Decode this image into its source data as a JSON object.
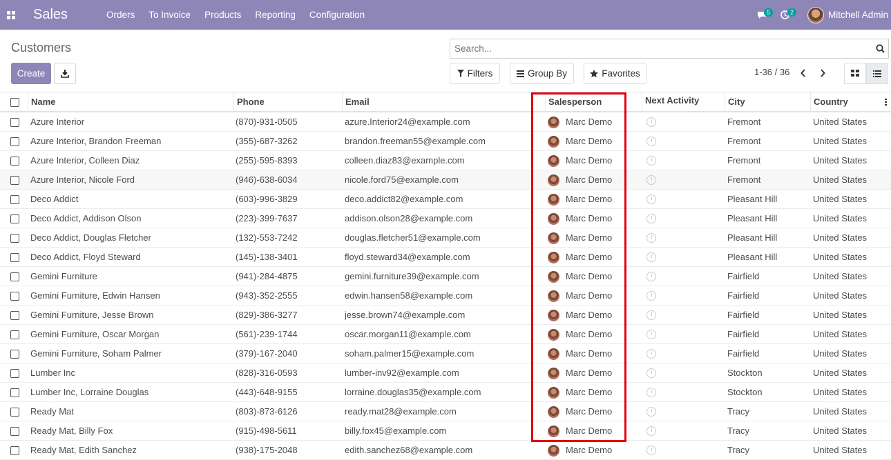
{
  "navbar": {
    "brand": "Sales",
    "menu": [
      "Orders",
      "To Invoice",
      "Products",
      "Reporting",
      "Configuration"
    ],
    "messages_count": "5",
    "activities_count": "2",
    "user_name": "Mitchell Admin"
  },
  "control_panel": {
    "title": "Customers",
    "create_label": "Create",
    "search_placeholder": "Search...",
    "filters_label": "Filters",
    "group_by_label": "Group By",
    "favorites_label": "Favorites",
    "pager": "1-36 / 36"
  },
  "columns": {
    "name": "Name",
    "phone": "Phone",
    "email": "Email",
    "salesperson": "Salesperson",
    "next_activity": "Next Activity",
    "city": "City",
    "country": "Country"
  },
  "rows": [
    {
      "name": "Azure Interior",
      "phone": "(870)-931-0505",
      "email": "azure.Interior24@example.com",
      "salesperson": "Marc Demo",
      "city": "Fremont",
      "country": "United States"
    },
    {
      "name": "Azure Interior, Brandon Freeman",
      "phone": "(355)-687-3262",
      "email": "brandon.freeman55@example.com",
      "salesperson": "Marc Demo",
      "city": "Fremont",
      "country": "United States"
    },
    {
      "name": "Azure Interior, Colleen Diaz",
      "phone": "(255)-595-8393",
      "email": "colleen.diaz83@example.com",
      "salesperson": "Marc Demo",
      "city": "Fremont",
      "country": "United States"
    },
    {
      "name": "Azure Interior, Nicole Ford",
      "phone": "(946)-638-6034",
      "email": "nicole.ford75@example.com",
      "salesperson": "Marc Demo",
      "city": "Fremont",
      "country": "United States"
    },
    {
      "name": "Deco Addict",
      "phone": "(603)-996-3829",
      "email": "deco.addict82@example.com",
      "salesperson": "Marc Demo",
      "city": "Pleasant Hill",
      "country": "United States"
    },
    {
      "name": "Deco Addict, Addison Olson",
      "phone": "(223)-399-7637",
      "email": "addison.olson28@example.com",
      "salesperson": "Marc Demo",
      "city": "Pleasant Hill",
      "country": "United States"
    },
    {
      "name": "Deco Addict, Douglas Fletcher",
      "phone": "(132)-553-7242",
      "email": "douglas.fletcher51@example.com",
      "salesperson": "Marc Demo",
      "city": "Pleasant Hill",
      "country": "United States"
    },
    {
      "name": "Deco Addict, Floyd Steward",
      "phone": "(145)-138-3401",
      "email": "floyd.steward34@example.com",
      "salesperson": "Marc Demo",
      "city": "Pleasant Hill",
      "country": "United States"
    },
    {
      "name": "Gemini Furniture",
      "phone": "(941)-284-4875",
      "email": "gemini.furniture39@example.com",
      "salesperson": "Marc Demo",
      "city": "Fairfield",
      "country": "United States"
    },
    {
      "name": "Gemini Furniture, Edwin Hansen",
      "phone": "(943)-352-2555",
      "email": "edwin.hansen58@example.com",
      "salesperson": "Marc Demo",
      "city": "Fairfield",
      "country": "United States"
    },
    {
      "name": "Gemini Furniture, Jesse Brown",
      "phone": "(829)-386-3277",
      "email": "jesse.brown74@example.com",
      "salesperson": "Marc Demo",
      "city": "Fairfield",
      "country": "United States"
    },
    {
      "name": "Gemini Furniture, Oscar Morgan",
      "phone": "(561)-239-1744",
      "email": "oscar.morgan11@example.com",
      "salesperson": "Marc Demo",
      "city": "Fairfield",
      "country": "United States"
    },
    {
      "name": "Gemini Furniture, Soham Palmer",
      "phone": "(379)-167-2040",
      "email": "soham.palmer15@example.com",
      "salesperson": "Marc Demo",
      "city": "Fairfield",
      "country": "United States"
    },
    {
      "name": "Lumber Inc",
      "phone": "(828)-316-0593",
      "email": "lumber-inv92@example.com",
      "salesperson": "Marc Demo",
      "city": "Stockton",
      "country": "United States"
    },
    {
      "name": "Lumber Inc, Lorraine Douglas",
      "phone": "(443)-648-9155",
      "email": "lorraine.douglas35@example.com",
      "salesperson": "Marc Demo",
      "city": "Stockton",
      "country": "United States"
    },
    {
      "name": "Ready Mat",
      "phone": "(803)-873-6126",
      "email": "ready.mat28@example.com",
      "salesperson": "Marc Demo",
      "city": "Tracy",
      "country": "United States"
    },
    {
      "name": "Ready Mat, Billy Fox",
      "phone": "(915)-498-5611",
      "email": "billy.fox45@example.com",
      "salesperson": "Marc Demo",
      "city": "Tracy",
      "country": "United States"
    },
    {
      "name": "Ready Mat, Edith Sanchez",
      "phone": "(938)-175-2048",
      "email": "edith.sanchez68@example.com",
      "salesperson": "Marc Demo",
      "city": "Tracy",
      "country": "United States"
    }
  ],
  "colors": {
    "navbar": "#8f86b8",
    "badge": "#00a09d",
    "highlight": "#e0000e"
  }
}
